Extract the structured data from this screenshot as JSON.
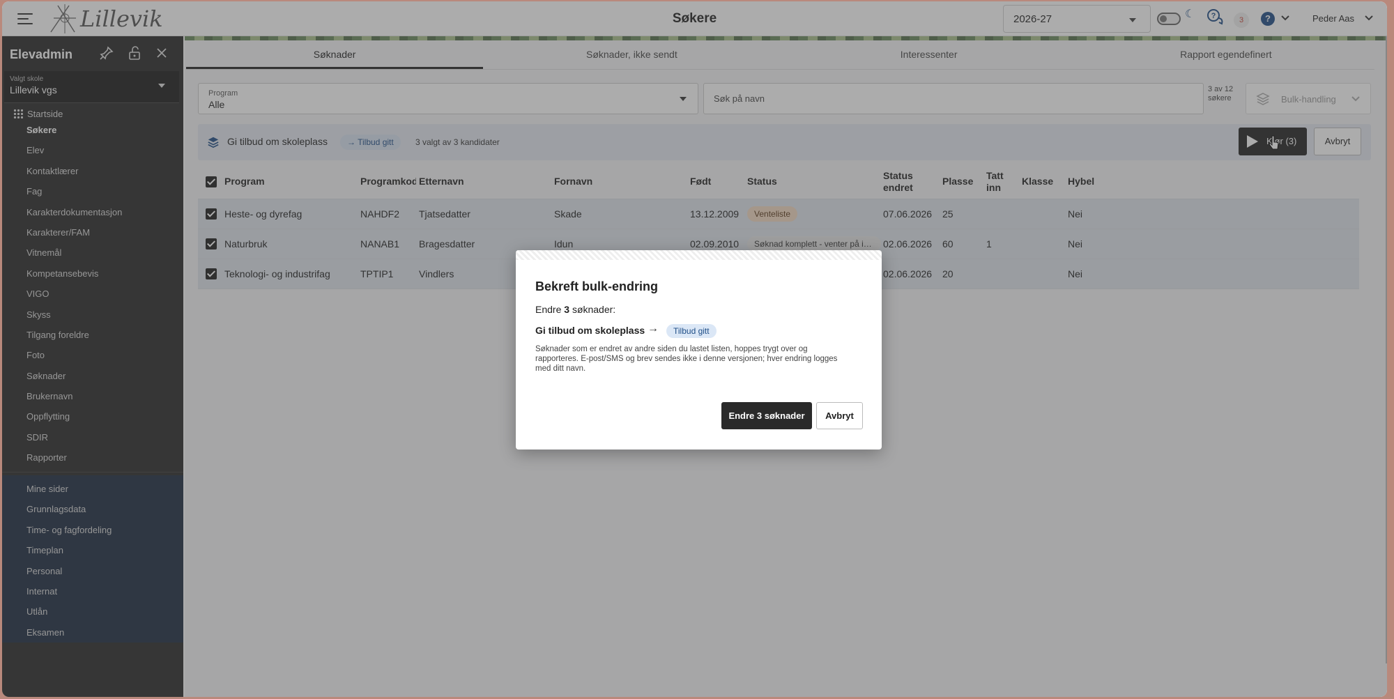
{
  "app": {
    "logo_text": "Lillevik",
    "page_title": "Søkere"
  },
  "topbar": {
    "year": "2026-27",
    "notification_count": "3",
    "help_label": "?",
    "moon_icon": "moon-icon",
    "user_name": "Peder Aas"
  },
  "sidebar": {
    "title": "Elevadmin",
    "school_label": "Valgt skole",
    "school_value": "Lillevik vgs",
    "home_label": "Startside",
    "items": [
      {
        "label": "Søkere",
        "active": true
      },
      {
        "label": "Elev"
      },
      {
        "label": "Kontaktlærer"
      },
      {
        "label": "Fag"
      },
      {
        "label": "Karakterdokumentasjon"
      },
      {
        "label": "Karakterer/FAM"
      },
      {
        "label": "Vitnemål"
      },
      {
        "label": "Kompetansebevis"
      },
      {
        "label": "VIGO"
      },
      {
        "label": "Skyss"
      },
      {
        "label": "Tilgang foreldre"
      },
      {
        "label": "Foto"
      },
      {
        "label": "Søknader"
      },
      {
        "label": "Brukernavn"
      },
      {
        "label": "Oppflytting"
      },
      {
        "label": "SDIR"
      },
      {
        "label": "Rapporter"
      }
    ],
    "section2": [
      {
        "label": "Mine sider"
      },
      {
        "label": "Grunnlagsdata"
      },
      {
        "label": "Time- og fagfordeling"
      },
      {
        "label": "Timeplan"
      },
      {
        "label": "Personal"
      },
      {
        "label": "Internat"
      },
      {
        "label": "Utlån"
      },
      {
        "label": "Eksamen"
      }
    ]
  },
  "tabs": [
    {
      "label": "Søknader",
      "active": true
    },
    {
      "label": "Søknader, ikke sendt"
    },
    {
      "label": "Interessenter"
    },
    {
      "label": "Rapport egendefinert"
    }
  ],
  "filters": {
    "program_label": "Program",
    "program_value": "Alle",
    "search_placeholder": "Søk på navn",
    "count_text": "3 av 12 søkere",
    "bulk_placeholder": "Bulk-handling"
  },
  "bulk": {
    "action": "Gi tilbud om skoleplass",
    "pill": "→ Tilbud gitt",
    "selected_text": "3 valgt av 3 kandidater",
    "run_label": "Kjør (3)",
    "cancel_label": "Avbryt"
  },
  "table": {
    "headers": [
      "Program",
      "Programkode",
      "Etternavn",
      "Fornavn",
      "Født",
      "Status",
      "Status endret",
      "Plasse",
      "Tatt inn",
      "Klasse",
      "Hybel"
    ],
    "rows": [
      {
        "program": "Heste- og dyrefag",
        "code": "NAHDF2",
        "last": "Tjatsedatter",
        "first": "Skade",
        "born": "13.12.2009",
        "status": "Venteliste",
        "status_kind": "waiting",
        "changed": "07.06.2026",
        "place": "25",
        "taken": "",
        "class": "",
        "dorm": "Nei"
      },
      {
        "program": "Naturbruk",
        "code": "NANAB1",
        "last": "Bragesdatter",
        "first": "Idun",
        "born": "02.09.2010",
        "status": "Søknad komplett - venter på inntak",
        "status_kind": "complete",
        "changed": "02.06.2026",
        "place": "60",
        "taken": "1",
        "class": "",
        "dorm": "Nei"
      },
      {
        "program": "Teknologi- og industrifag",
        "code": "TPTIP1",
        "last": "Vindlers",
        "first": "",
        "born": "",
        "status": "Søknad komplett - venter på inntak",
        "status_kind": "complete",
        "changed": "02.06.2026",
        "place": "20",
        "taken": "",
        "class": "",
        "dorm": "Nei"
      }
    ]
  },
  "dialog": {
    "title": "Bekreft bulk-endring",
    "sub_prefix": "Endre",
    "sub_count": "3",
    "sub_suffix": "søknader:",
    "action": "Gi tilbud om skoleplass",
    "arrow": "→",
    "pill": "Tilbud gitt",
    "note": "Søknader som er endret av andre siden du lastet listen, hoppes trygt over og rapporteres. E-post/SMS og brev sendes ikke i denne versjonen; hver endring logges med ditt navn.",
    "confirm_label": "Endre 3 søknader",
    "cancel_label": "Avbryt"
  }
}
